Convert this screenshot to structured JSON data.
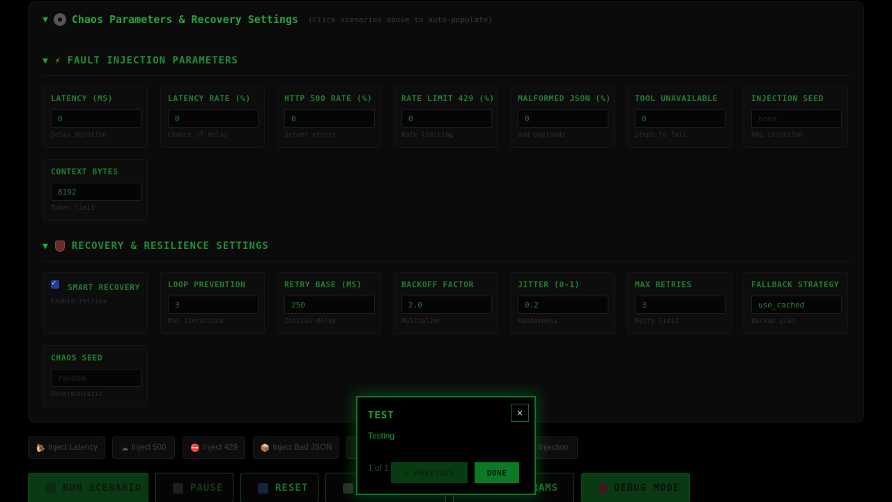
{
  "panel": {
    "toggle": "▼",
    "title": "Chaos Parameters & Recovery Settings",
    "hint": "(Click scenarios above to auto-populate)"
  },
  "fault_section": {
    "toggle": "▼",
    "icon": "⚡",
    "title": "FAULT INJECTION PARAMETERS"
  },
  "fault_params": [
    {
      "label": "LATENCY (MS)",
      "value": "0",
      "placeholder": "",
      "help": "Delay duration"
    },
    {
      "label": "LATENCY RATE (%)",
      "value": "0",
      "placeholder": "",
      "help": "Chance of delay"
    },
    {
      "label": "HTTP 500 RATE (%)",
      "value": "0",
      "placeholder": "",
      "help": "Server errors"
    },
    {
      "label": "RATE LIMIT 429 (%)",
      "value": "0",
      "placeholder": "",
      "help": "Rate limiting"
    },
    {
      "label": "MALFORMED JSON (%)",
      "value": "0",
      "placeholder": "",
      "help": "Bad payloads"
    },
    {
      "label": "TOOL UNAVAILABLE",
      "value": "0",
      "placeholder": "",
      "help": "Steps to fail"
    },
    {
      "label": "INJECTION SEED",
      "value": "",
      "placeholder": "none",
      "help": "RAG injection"
    },
    {
      "label": "CONTEXT BYTES",
      "value": "8192",
      "placeholder": "",
      "help": "Token limit"
    }
  ],
  "recovery_section": {
    "toggle": "▼",
    "title": "RECOVERY & RESILIENCE SETTINGS"
  },
  "smart_recovery": {
    "label": "SMART RECOVERY",
    "help": "Enable retries",
    "checked": true
  },
  "recovery_params": [
    {
      "label": "LOOP PREVENTION",
      "value": "3",
      "placeholder": "",
      "help": "Max iterations"
    },
    {
      "label": "RETRY BASE (MS)",
      "value": "250",
      "placeholder": "",
      "help": "Initial delay"
    },
    {
      "label": "BACKOFF FACTOR",
      "value": "2.0",
      "placeholder": "",
      "help": "Multiplier"
    },
    {
      "label": "JITTER (0-1)",
      "value": "0.2",
      "placeholder": "",
      "help": "Randomness"
    },
    {
      "label": "MAX RETRIES",
      "value": "3",
      "placeholder": "",
      "help": "Retry limit"
    },
    {
      "label": "FALLBACK STRATEGY",
      "value": "use_cached",
      "placeholder": "",
      "help": "Backup plan"
    },
    {
      "label": "CHAOS SEED",
      "value": "",
      "placeholder": "random",
      "help": "Deterministic"
    }
  ],
  "inject_buttons": [
    {
      "icon": "🐌",
      "label": "Inject Latency"
    },
    {
      "icon": "☁",
      "label": "Inject 500"
    },
    {
      "icon": "⛔",
      "label": "Inject 429"
    },
    {
      "icon": "📦",
      "label": "Inject Bad JSON"
    },
    {
      "icon": "",
      "label": ""
    },
    {
      "icon": "",
      "label": "s Injection"
    }
  ],
  "actions": [
    {
      "icon": "▶",
      "label": "RUN SCENARIO"
    },
    {
      "icon": "⏸",
      "label": "PAUSE"
    },
    {
      "icon": "🔄",
      "label": "RESET"
    },
    {
      "icon": "🎲",
      "label": ""
    },
    {
      "icon": "",
      "label": "RAMS"
    },
    {
      "icon": "🔧",
      "label": "DEBUG MODE"
    }
  ],
  "modal": {
    "title": "TEST",
    "close": "×",
    "body": "Testing",
    "counter": "1 of 1",
    "prev_label": "← PREVIOUS",
    "done_label": "DONE"
  }
}
